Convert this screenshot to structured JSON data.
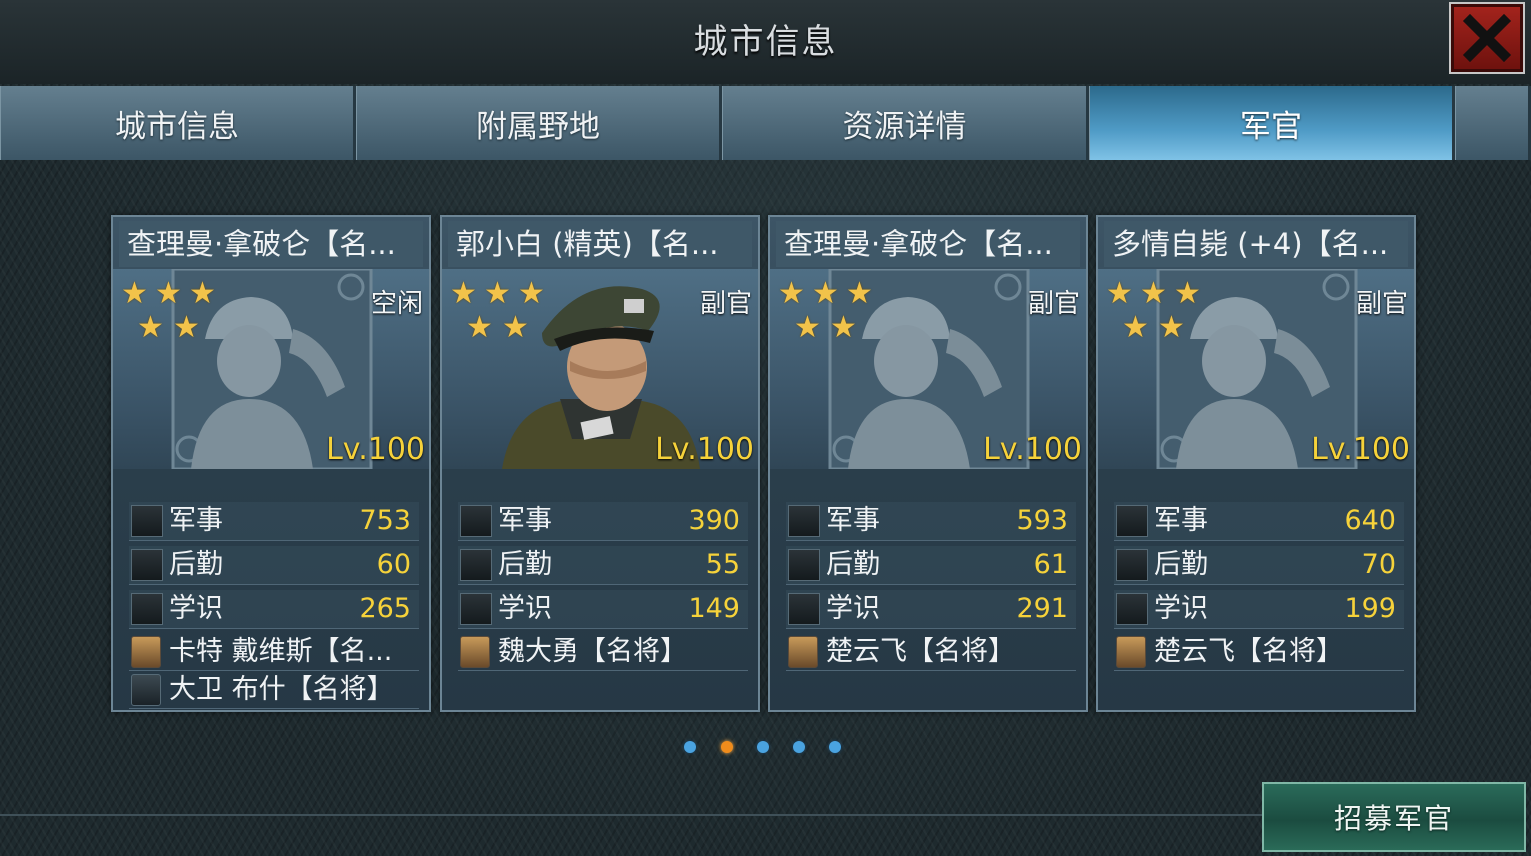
{
  "window": {
    "title": "城市信息",
    "close_icon": "close-x-icon",
    "accent_red": "#a5241d"
  },
  "tabs": [
    {
      "label": "城市信息",
      "active": false
    },
    {
      "label": "附属野地",
      "active": false
    },
    {
      "label": "资源详情",
      "active": false
    },
    {
      "label": "军官",
      "active": true
    }
  ],
  "cards": [
    {
      "name": "查理曼·拿破仑【名...",
      "status": "空闲",
      "level": "Lv.100",
      "stars": 5,
      "portrait": "silhouette",
      "stats": [
        {
          "label": "军事",
          "value": "753",
          "icon": "military-icon"
        },
        {
          "label": "后勤",
          "value": "60",
          "icon": "logistics-icon"
        },
        {
          "label": "学识",
          "value": "265",
          "icon": "knowledge-icon"
        }
      ],
      "subordinates": [
        "卡特 戴维斯【名...",
        "大卫 布什【名将】"
      ]
    },
    {
      "name": "郭小白 (精英)【名...",
      "status": "副官",
      "level": "Lv.100",
      "stars": 5,
      "portrait": "officer",
      "stats": [
        {
          "label": "军事",
          "value": "390",
          "icon": "military-icon"
        },
        {
          "label": "后勤",
          "value": "55",
          "icon": "logistics-icon"
        },
        {
          "label": "学识",
          "value": "149",
          "icon": "knowledge-icon"
        }
      ],
      "subordinates": [
        "魏大勇【名将】"
      ]
    },
    {
      "name": "查理曼·拿破仑【名...",
      "status": "副官",
      "level": "Lv.100",
      "stars": 5,
      "portrait": "silhouette",
      "stats": [
        {
          "label": "军事",
          "value": "593",
          "icon": "military-icon"
        },
        {
          "label": "后勤",
          "value": "61",
          "icon": "logistics-icon"
        },
        {
          "label": "学识",
          "value": "291",
          "icon": "knowledge-icon"
        }
      ],
      "subordinates": [
        "楚云飞【名将】"
      ]
    },
    {
      "name": "多情自毙 (+4)【名...",
      "status": "副官",
      "level": "Lv.100",
      "stars": 5,
      "portrait": "silhouette",
      "stats": [
        {
          "label": "军事",
          "value": "640",
          "icon": "military-icon"
        },
        {
          "label": "后勤",
          "value": "70",
          "icon": "logistics-icon"
        },
        {
          "label": "学识",
          "value": "199",
          "icon": "knowledge-icon"
        }
      ],
      "subordinates": [
        "楚云飞【名将】"
      ]
    }
  ],
  "pagination": {
    "total": 5,
    "current": 2
  },
  "recruit_button": {
    "label": "招募军官",
    "color": "#2a6b5a"
  }
}
